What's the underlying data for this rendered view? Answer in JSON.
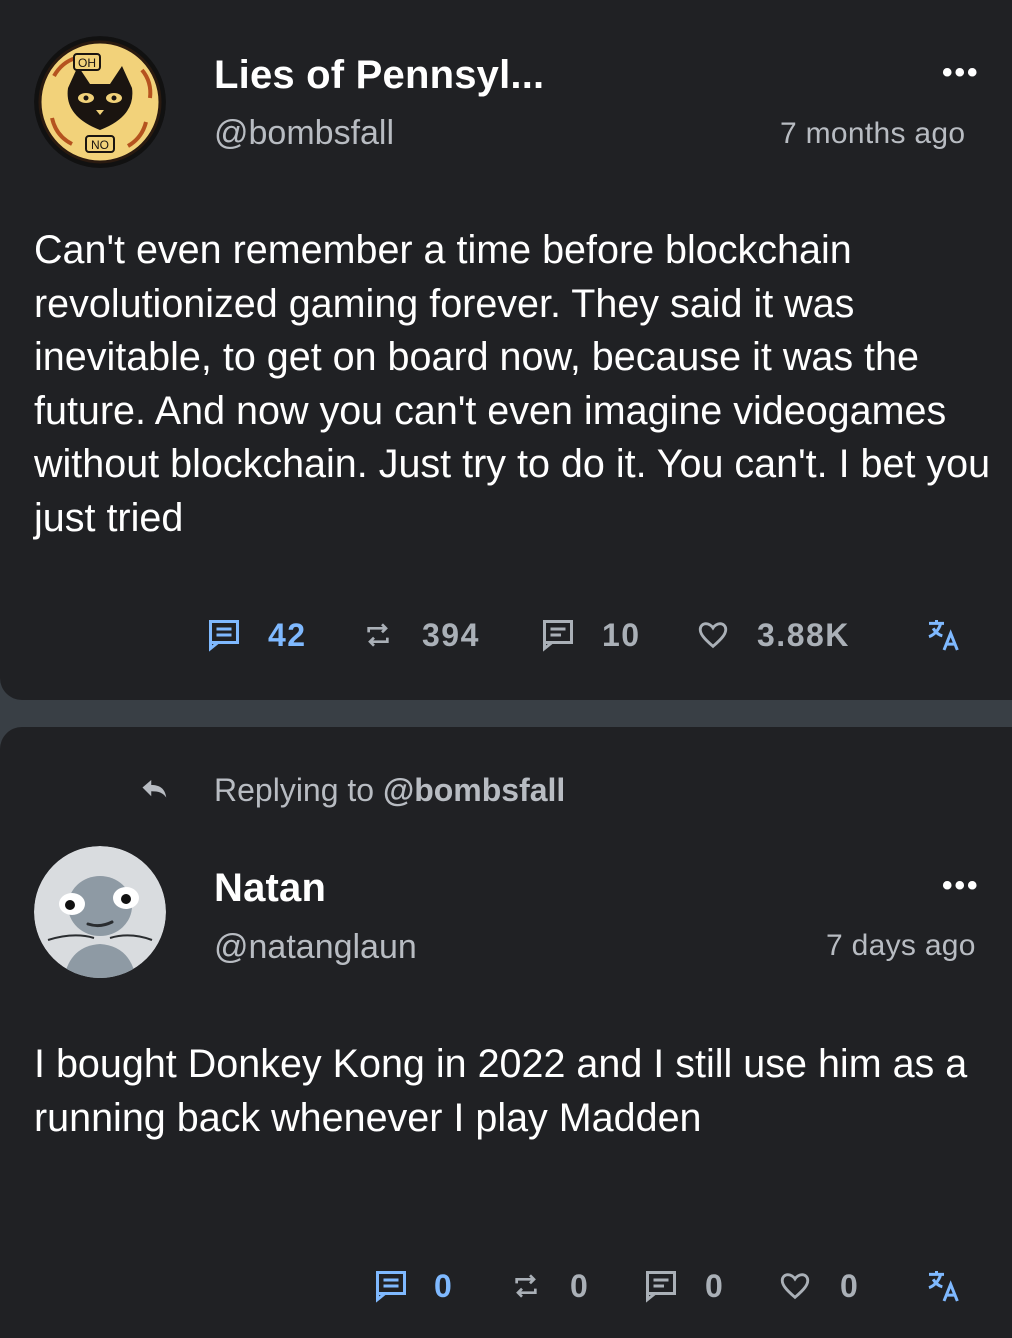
{
  "posts": [
    {
      "author_name": "Lies of Pennsyl...",
      "handle": "@bombsfall",
      "time": "7 months ago",
      "avatar": {
        "icon": "cat-emblem-avatar",
        "badge_top": "OH",
        "badge_bottom": "NO"
      },
      "body": "Can't even remember a time before blockchain revolutionized gaming forever. They said it was inevitable, to get on board now, because it was the future. And now you can't even imagine videogames without blockchain. Just try to do it. You can't. I bet you just tried",
      "stats": {
        "replies": "42",
        "reposts": "394",
        "quotes": "10",
        "likes": "3.88K"
      }
    },
    {
      "author_name": "Natan",
      "handle": "@natanglaun",
      "time": "7 days ago",
      "avatar": {
        "icon": "cartoon-face-avatar"
      },
      "replying_prefix": "Replying to ",
      "replying_handle": "@bombsfall",
      "body": "I bought Donkey Kong in 2022 and I still use him as a  running back whenever I play Madden",
      "stats": {
        "replies": "0",
        "reposts": "0",
        "quotes": "0",
        "likes": "0"
      }
    }
  ],
  "more_label": "•••",
  "colors": {
    "card": "#202124",
    "divider": "#393f45",
    "accent": "#7fb9ff",
    "muted": "#aab0b7"
  }
}
